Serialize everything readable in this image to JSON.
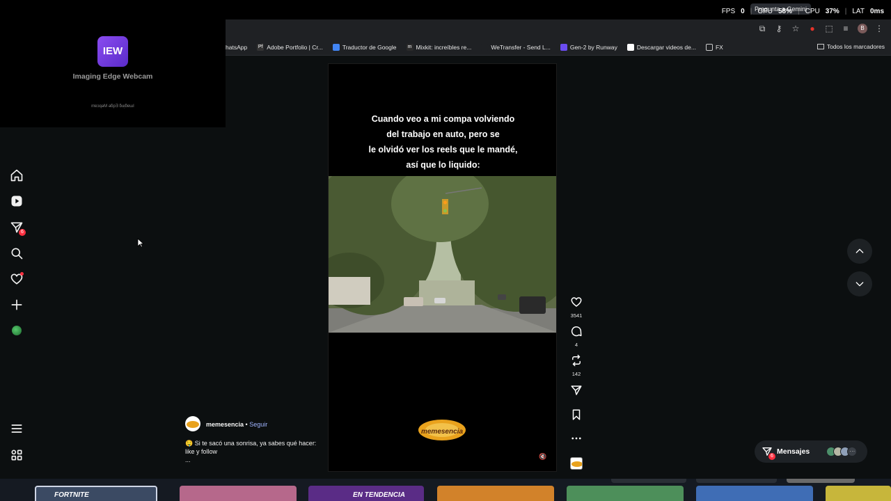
{
  "topbar": {
    "gemini": "Pregunta a Gemini",
    "fps_label": "FPS",
    "fps_value": "0",
    "gpu_label": "GPU",
    "gpu_value": "58%",
    "cpu_label": "CPU",
    "cpu_value": "37%",
    "lat_label": "LAT",
    "lat_value": "0ms"
  },
  "bookmarks": [
    {
      "label": "hatsApp",
      "color": "#1f2124"
    },
    {
      "label": "Adobe Portfolio | Cr...",
      "color": "#222"
    },
    {
      "label": "Traductor de Google",
      "color": "#4285f4"
    },
    {
      "label": "Mixkit: increíbles re...",
      "color": "#333"
    },
    {
      "label": "WeTransfer - Send L...",
      "color": "#1f2124"
    },
    {
      "label": "Gen-2 by Runway",
      "color": "#6a4cf0"
    },
    {
      "label": "Descargar videos de...",
      "color": "#ffffff"
    },
    {
      "label": "FX",
      "color": "#1f2124"
    }
  ],
  "bookmarks_all": "Todos los marcadores",
  "webcam": {
    "logo": "IEW",
    "name": "Imaging Edge Webcam",
    "mirrored": "mɐɔqǝM ǝƃpƎ ƃuᴉƃɐɯI"
  },
  "nav": {
    "messages_badge": "6",
    "icons": [
      "home-icon",
      "reels-icon",
      "messages-icon",
      "search-icon",
      "notifications-icon",
      "create-icon",
      "profile-avatar"
    ]
  },
  "reel": {
    "caption_lines": [
      "Cuando veo a mi compa volviendo",
      "del trabajo en auto, pero se",
      "le olvidó ver los reels que le mandé,",
      "así que lo liquido:"
    ],
    "watermark": "memesencia"
  },
  "actions": {
    "likes": "3541",
    "comments": "4",
    "reposts": "142"
  },
  "author": {
    "name": "memesencia",
    "separator": " • ",
    "follow": "Seguir",
    "description": "🤤 Si te sacó una sonrisa, ya sabes qué hacer: like y follow",
    "more": "..."
  },
  "messages": {
    "label": "Mensajes",
    "badge": "6"
  },
  "bottom": {
    "tile1": "FORTNITE",
    "tile2": "EN TENDENCIA"
  },
  "colors": {
    "accent_red": "#ff3040",
    "link_blue": "#9fb4ff",
    "background": "#0c0f10"
  }
}
